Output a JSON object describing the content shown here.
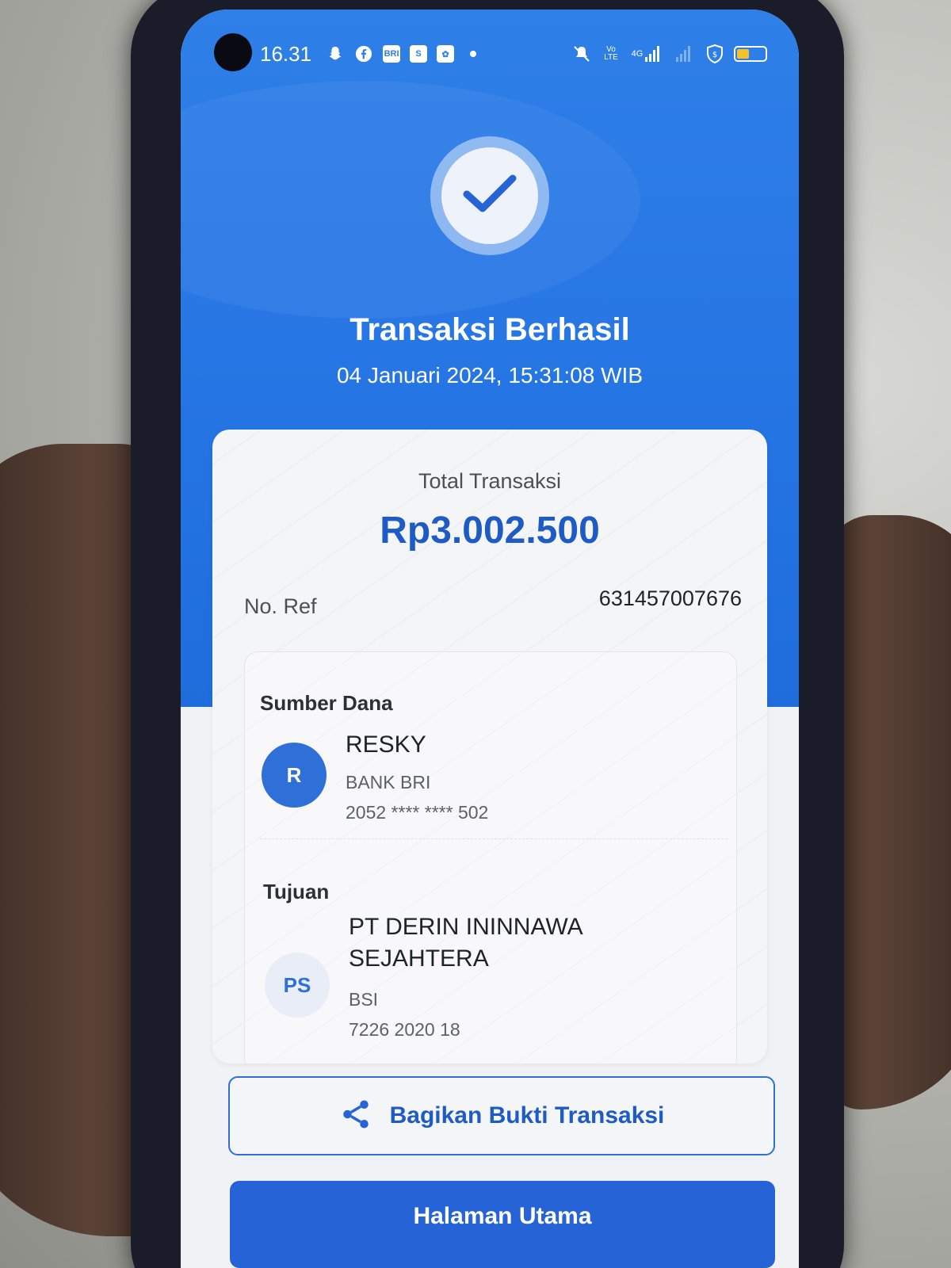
{
  "status_bar": {
    "time": "16.31",
    "icons_left": [
      "snapchat-icon",
      "facebook-icon",
      "brimo-icon",
      "shopee-icon",
      "app-icon",
      "dot-icon"
    ],
    "icons_right": [
      "mute-icon",
      "volte-icon",
      "signal-4g-icon",
      "signal-icon",
      "shield-icon",
      "battery-icon"
    ],
    "volte_label": "Vo LTE",
    "network_label": "4G",
    "battery_level": 0.45,
    "battery_color": "#f3c12c"
  },
  "header": {
    "title": "Transaksi Berhasil",
    "datetime": "04 Januari 2024, 15:31:08 WIB",
    "check_icon": "check-icon",
    "primary_color": "#2f7fe8"
  },
  "receipt": {
    "total_label": "Total Transaksi",
    "total_amount": "Rp3.002.500",
    "ref_label": "No. Ref",
    "ref_value": "631457007676",
    "source": {
      "section_label": "Sumber Dana",
      "avatar_initials": "R",
      "name": "RESKY",
      "bank": "BANK BRI",
      "account": "2052 **** **** 502"
    },
    "destination": {
      "section_label": "Tujuan",
      "avatar_initials": "PS",
      "name_line1": "PT DERIN ININNAWA",
      "name_line2": "SEJAHTERA",
      "bank": "BSI",
      "account": "7226 2020 18"
    }
  },
  "actions": {
    "share_label": "Bagikan Bukti Transaksi",
    "share_icon": "share-icon",
    "home_label": "Halaman Utama",
    "accent_color": "#2563d6"
  }
}
